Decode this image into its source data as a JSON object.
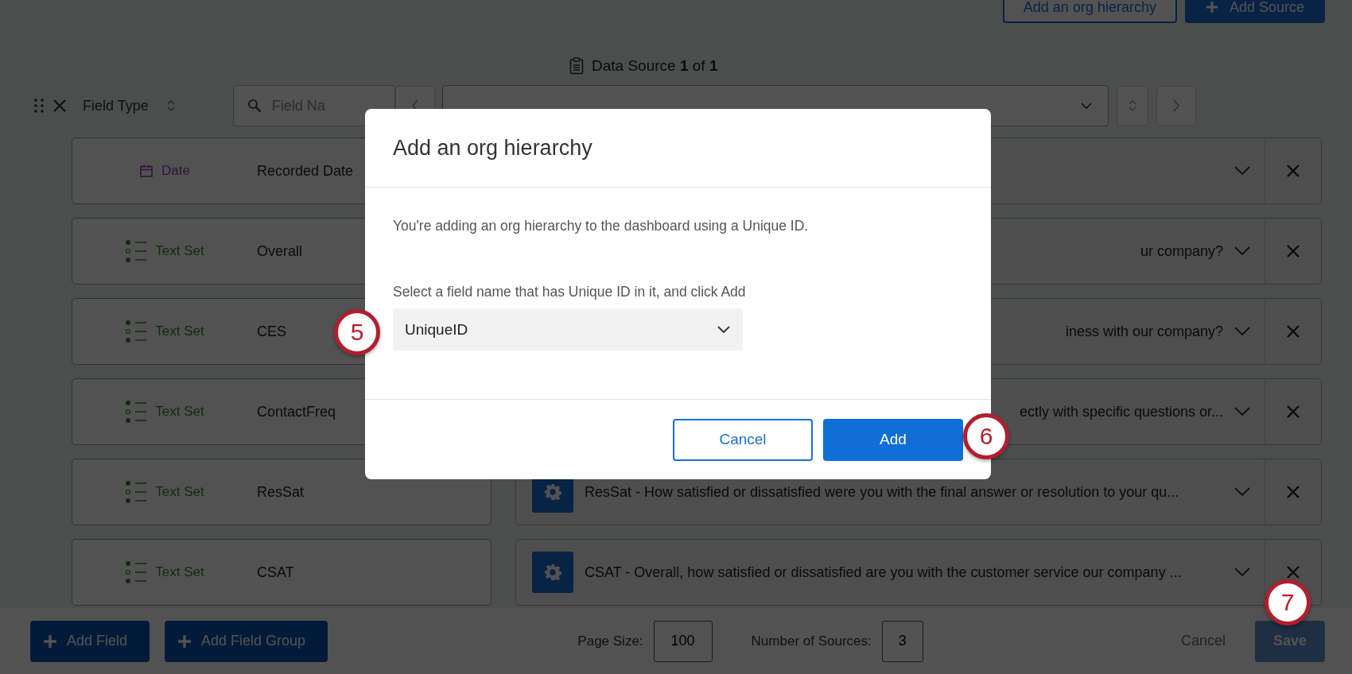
{
  "header_buttons": [
    {
      "label": "Add an org hierarchy",
      "kind": "outline"
    },
    {
      "label": "Add Source",
      "kind": "primary"
    }
  ],
  "data_source": {
    "label": "Data Source **1** of **1**"
  },
  "toolbar": {
    "column_label": "Field Type",
    "search": {
      "placeholder": "Field Na"
    }
  },
  "fields": [
    {
      "kind": "date",
      "type_label": "Date",
      "name": "Recorded Date",
      "mapping": {
        "kind": "hidden"
      }
    },
    {
      "kind": "text_set",
      "type_label": "Text Set",
      "name": "Overall",
      "mapping": {
        "kind": "partial",
        "text": "ur company?"
      }
    },
    {
      "kind": "text_set",
      "type_label": "Text Set",
      "name": "CES",
      "mapping": {
        "kind": "partial",
        "text": "iness with our company?"
      }
    },
    {
      "kind": "text_set",
      "type_label": "Text Set",
      "name": "ContactFreq",
      "mapping": {
        "kind": "partial",
        "text": "ectly with specific questions or..."
      }
    },
    {
      "kind": "text_set",
      "type_label": "Text Set",
      "name": "ResSat",
      "mapping": {
        "kind": "full",
        "text": "ResSat - How satisfied or dissatisfied were you with the final answer or resolution to your qu..."
      }
    },
    {
      "kind": "text_set",
      "type_label": "Text Set",
      "name": "CSAT",
      "mapping": {
        "kind": "full",
        "text": "CSAT - Overall, how satisfied or dissatisfied are you with the customer service our company ..."
      }
    }
  ],
  "footer": {
    "buttons": [
      {
        "label": "Add Field"
      },
      {
        "label": "Add Field Group"
      }
    ],
    "page_size": {
      "label": "Page Size:",
      "value": "100"
    },
    "sources": {
      "label": "Number of Sources:",
      "value": "3"
    },
    "actions": [
      {
        "label": "Cancel",
        "kind": "link",
        "disabled": true
      },
      {
        "label": "Save",
        "kind": "primary",
        "disabled": true
      }
    ]
  },
  "dialog": {
    "title": "Add an org hierarchy",
    "message": "You're adding an org hierarchy to the dashboard using a Unique ID.",
    "field_label": "Select a field name that has Unique ID in it, and click Add",
    "select_value": "UniqueID",
    "buttons": [
      {
        "label": "Cancel",
        "kind": "secondary"
      },
      {
        "label": "Add",
        "kind": "primary"
      }
    ]
  },
  "callouts": [
    "5",
    "6",
    "7"
  ]
}
